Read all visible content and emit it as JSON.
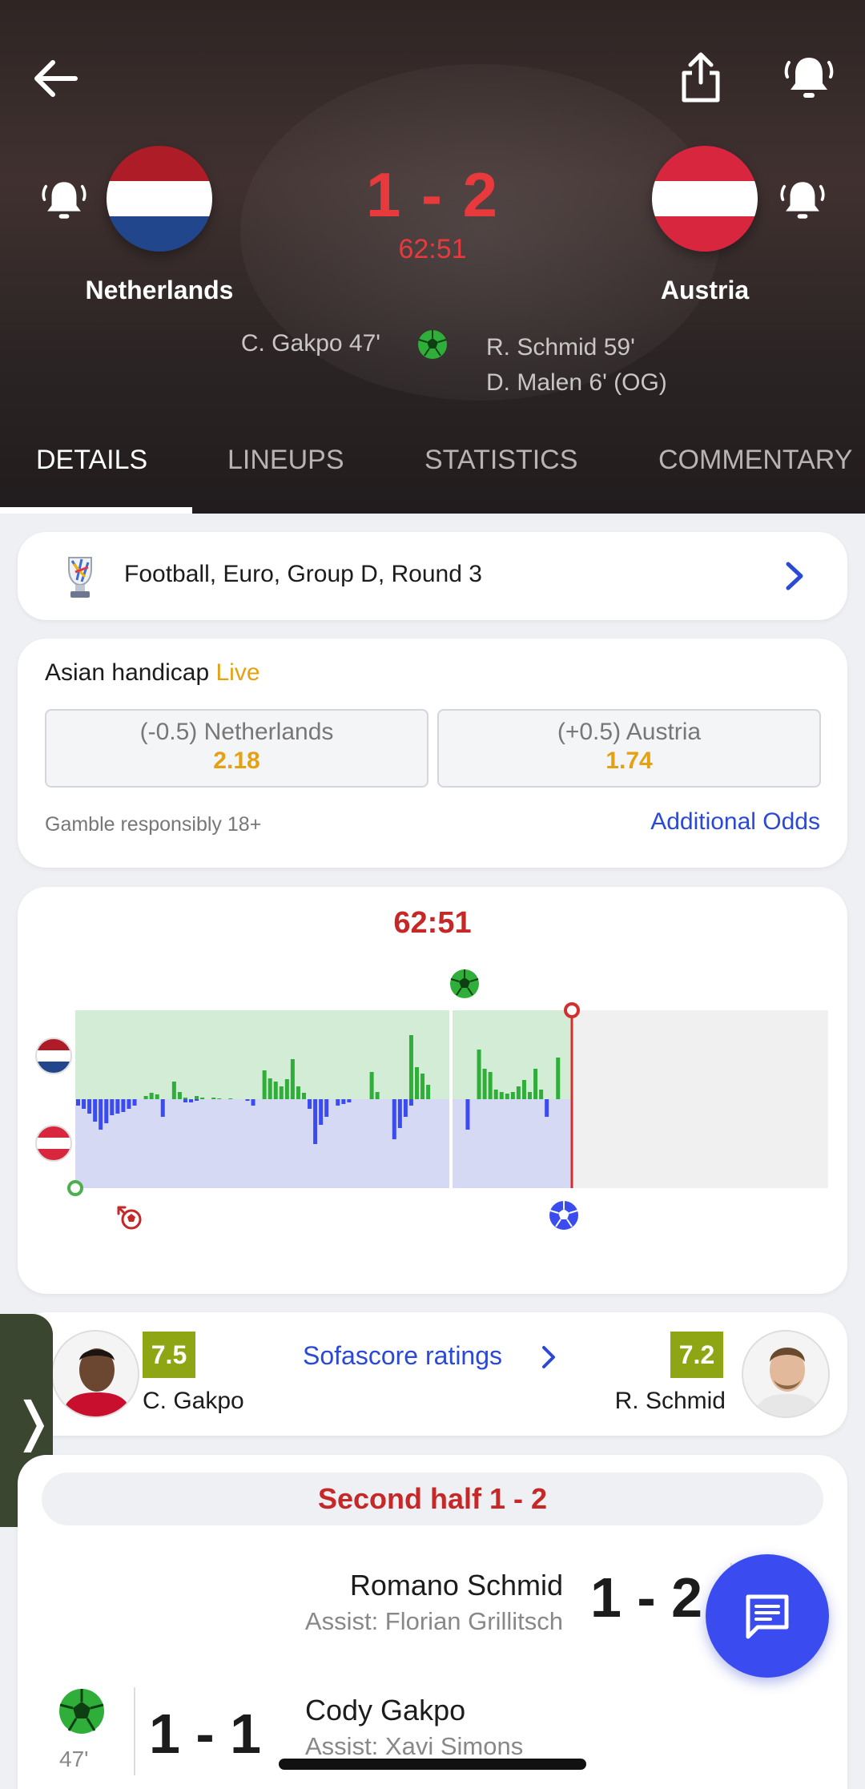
{
  "match": {
    "home_team": "Netherlands",
    "away_team": "Austria",
    "score": "1 - 2",
    "clock": "62:51",
    "home_scorers": [
      "C. Gakpo 47'"
    ],
    "away_scorers": [
      "R. Schmid 59'",
      "D. Malen 6' (OG)"
    ]
  },
  "colors": {
    "accent_red": "#e83a3c",
    "link_blue": "#2a49d6",
    "odds_orange": "#e4a112",
    "rating_green": "#8ea613",
    "home_flag": [
      "#ae1c28",
      "#ffffff",
      "#21468b"
    ],
    "away_flag": [
      "#d7263d",
      "#ffffff",
      "#d7263d"
    ]
  },
  "tabs": [
    {
      "label": "DETAILS",
      "active": true
    },
    {
      "label": "LINEUPS",
      "active": false
    },
    {
      "label": "STATISTICS",
      "active": false
    },
    {
      "label": "COMMENTARY",
      "active": false
    }
  ],
  "tournament": {
    "label": "Football, Euro, Group D, Round 3",
    "logo_icon": "euro-trophy-icon"
  },
  "odds": {
    "title": "Asian handicap",
    "live_label": "Live",
    "home": {
      "label": "(-0.5) Netherlands",
      "value": "2.18"
    },
    "away": {
      "label": "(+0.5) Austria",
      "value": "1.74"
    },
    "responsible": "Gamble responsibly 18+",
    "more_link": "Additional Odds"
  },
  "momentum": {
    "clock": "62:51",
    "home_pos": [
      0,
      0,
      0,
      0,
      0,
      0,
      0,
      0,
      0,
      0,
      0,
      0,
      4,
      8,
      6,
      0,
      0,
      22,
      9,
      2,
      0,
      4,
      2,
      0,
      2,
      1,
      0,
      1,
      0,
      0,
      0,
      0,
      0,
      36,
      26,
      22,
      16,
      25,
      50,
      16,
      8,
      0,
      0,
      0,
      0,
      0,
      0,
      0,
      0,
      0,
      0,
      0,
      34,
      9,
      0,
      0,
      0,
      0,
      0,
      80,
      40,
      32,
      18,
      0,
      0,
      0,
      0,
      0,
      0,
      0,
      0,
      62,
      38,
      34,
      12,
      9,
      7,
      9,
      16,
      24,
      9,
      38,
      12,
      0,
      0,
      52,
      0
    ],
    "away_neg": [
      8,
      12,
      18,
      28,
      38,
      30,
      20,
      18,
      16,
      12,
      8,
      0,
      0,
      0,
      0,
      22,
      0,
      0,
      0,
      4,
      4,
      2,
      0,
      0,
      0,
      0,
      0,
      0,
      0,
      0,
      2,
      8,
      0,
      0,
      0,
      0,
      0,
      0,
      0,
      0,
      0,
      12,
      56,
      32,
      22,
      0,
      8,
      6,
      4,
      0,
      0,
      0,
      0,
      0,
      0,
      0,
      50,
      36,
      22,
      8,
      0,
      0,
      0,
      0,
      0,
      0,
      0,
      0,
      0,
      38,
      0,
      0,
      0,
      0,
      0,
      0,
      0,
      0,
      0,
      0,
      0,
      0,
      0,
      22,
      0,
      0
    ]
  },
  "ratings": {
    "home": {
      "name": "C. Gakpo",
      "rating": "7.5"
    },
    "away": {
      "name": "R. Schmid",
      "rating": "7.2"
    },
    "link": "Sofascore ratings"
  },
  "events": {
    "period": "Second half 1 - 2",
    "away_goal": {
      "player": "Romano Schmid",
      "assist": "Assist: Florian Grillitsch",
      "score": "1 - 2"
    },
    "home_goal": {
      "player": "Cody Gakpo",
      "assist": "Assist: Xavi Simons",
      "score": "1 - 1",
      "minute": "47'"
    }
  },
  "side_tab": {
    "glyph": "❭"
  }
}
